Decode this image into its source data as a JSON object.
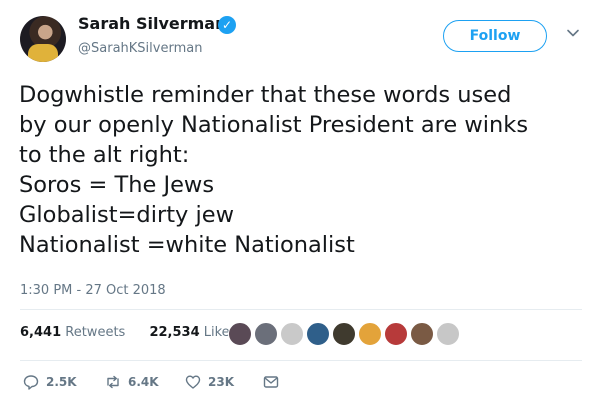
{
  "author": {
    "name": "Sarah Silverman",
    "handle": "@SarahKSilverman",
    "verified_mark": "✓"
  },
  "follow_label": "Follow",
  "tweet": {
    "text": "Dogwhistle reminder that these words used\nby our openly Nationalist President are winks\nto the alt right:\nSoros = The Jews\nGlobalist=dirty jew\nNationalist =white Nationalist",
    "timestamp": "1:30 PM - 27 Oct 2018"
  },
  "stats": {
    "retweets_value": "6,441",
    "retweets_label": "Retweets",
    "likes_value": "22,534",
    "likes_label": "Likes"
  },
  "likers_colors": [
    "#5a4a56",
    "#6b6f7a",
    "#c9c9c9",
    "#2f5f8a",
    "#3f3a2e",
    "#e3a33a",
    "#b73a3a",
    "#7a5a44",
    "#c7c7c7"
  ],
  "actions": {
    "reply_count": "2.5K",
    "retweet_count": "6.4K",
    "like_count": "23K"
  },
  "colors": {
    "accent": "#1da1f2",
    "secondary_text": "#657786"
  }
}
